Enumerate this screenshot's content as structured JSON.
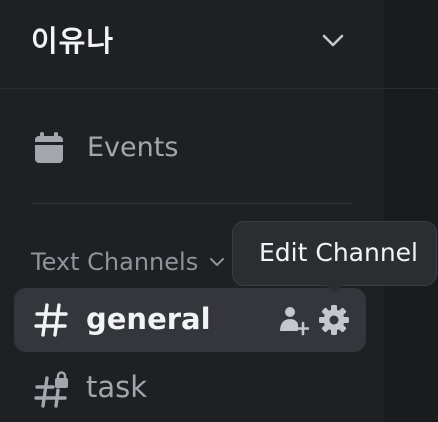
{
  "server": {
    "name": "이유나"
  },
  "events": {
    "label": "Events"
  },
  "category": {
    "label": "Text Channels"
  },
  "channels": [
    {
      "label": "general"
    },
    {
      "label": "task"
    }
  ],
  "tooltip": {
    "label": "Edit Channel"
  },
  "icons": {
    "server_chevron": "chevron-down-icon",
    "events": "calendar-icon",
    "category_chevron": "chevron-down-icon",
    "general": "hash-icon",
    "invite": "invite-member-icon",
    "settings": "gear-icon",
    "task": "hash-lock-icon"
  },
  "colors": {
    "sidebar_bg": "#1f2024",
    "selected_bg": "#35363c",
    "text_bright": "#f2f3f5",
    "text_muted": "#a3a6ad",
    "tooltip_bg": "#2b2d31"
  }
}
